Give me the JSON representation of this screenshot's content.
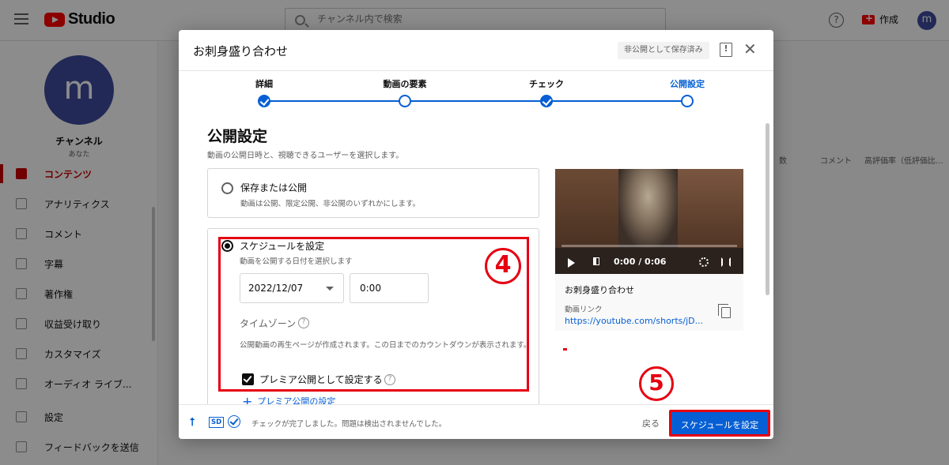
{
  "topbar": {
    "logo_text": "Studio",
    "search_placeholder": "チャンネル内で検索",
    "help_glyph": "?",
    "create_label": "作成",
    "avatar_letter": "m"
  },
  "sidebar": {
    "avatar_letter": "m",
    "channel_name": "チャンネル",
    "channel_sub": "あなた",
    "items": [
      {
        "label": "コンテンツ",
        "active": true
      },
      {
        "label": "アナリティクス"
      },
      {
        "label": "コメント"
      },
      {
        "label": "字幕"
      },
      {
        "label": "著作権"
      },
      {
        "label": "収益受け取り"
      },
      {
        "label": "カスタマイズ"
      },
      {
        "label": "オーディオ ライブ..."
      },
      {
        "label": "設定"
      },
      {
        "label": "フィードバックを送信"
      }
    ]
  },
  "background_table": {
    "col1": "数",
    "col2": "コメント",
    "col3": "高評価率（低評価比..."
  },
  "dialog": {
    "title": "お刺身盛り合わせ",
    "saved_badge": "非公開として保存済み",
    "feedback_glyph": "!",
    "close_glyph": "✕",
    "steps": [
      {
        "label": "詳細",
        "state": "done"
      },
      {
        "label": "動画の要素",
        "state": "todo"
      },
      {
        "label": "チェック",
        "state": "done"
      },
      {
        "label": "公開設定",
        "state": "current"
      }
    ],
    "section_title": "公開設定",
    "section_sub": "動画の公開日時と、視聴できるユーザーを選択します。",
    "option_publish": {
      "title": "保存または公開",
      "desc": "動画は公開、限定公開、非公開のいずれかにします。"
    },
    "option_schedule": {
      "title": "スケジュールを設定",
      "desc": "動画を公開する日付を選択します",
      "date": "2022/12/07",
      "time": "0:00",
      "timezone_label": "タイムゾーン",
      "question_glyph": "?",
      "premiere_desc": "公開動画の再生ページが作成されます。この日までのカウントダウンが表示されます。",
      "premiere_checkbox": "プレミア公開として設定する",
      "premiere_link": "プレミア公開の設定",
      "premiere_plus": "+"
    },
    "preview": {
      "time": "0:00 / 0:06",
      "progress": 0.0,
      "title": "お刺身盛り合わせ",
      "link_label": "動画リンク",
      "url": "https://youtube.com/shorts/jD..."
    },
    "footer": {
      "upload_glyph": "⭡",
      "sd_badge": "SD",
      "status": "チェックが完了しました。問題は検出されませんでした。",
      "back": "戻る",
      "schedule_button": "スケジュールを設定"
    }
  },
  "annotations": {
    "marker4": "4",
    "marker5": "5",
    "color": "#e60012"
  },
  "colors": {
    "accent": "#065fd4",
    "youtube_red": "#ff0000",
    "annotation_red": "#e60012"
  }
}
